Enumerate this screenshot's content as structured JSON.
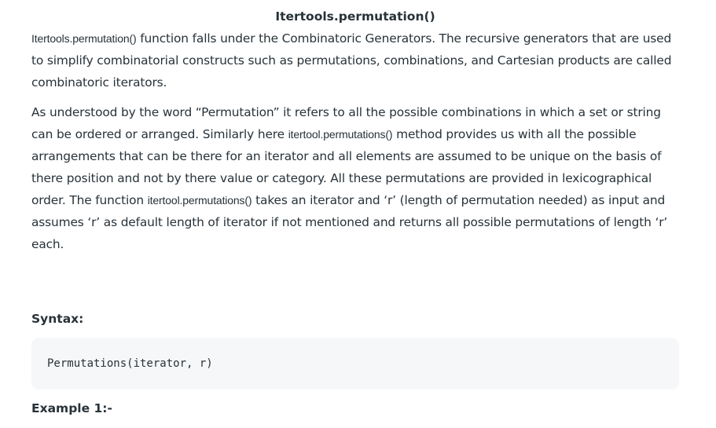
{
  "article": {
    "title": "Itertools.permutation()",
    "paragraph1": {
      "code": "Itertools.permutation()",
      "text": " function falls under the Combinatoric Generators. The recursive generators that are used to simplify combinatorial constructs such as permutations, combinations, and Cartesian products are called combinatoric iterators."
    },
    "paragraph2": {
      "text_a": "As understood by the word “Permutation” it refers to all the possible combinations in which a set or string can be ordered or arranged. Similarly here ",
      "code_a": "itertool.permutations()",
      "text_b": " method provides us with all the possible arrangements that can be there for an iterator and all elements are assumed to be unique on the basis of there position and not by there value or category. All these permutations are provided in lexicographical order. The function ",
      "code_b": "itertool.permutations()",
      "text_c": " takes an iterator and ‘r’ (length of permutation needed) as input and assumes ‘r’ as default length of iterator if not mentioned and returns all possible permutations of length ‘r’ each."
    },
    "syntax_label": "Syntax:",
    "syntax_code": "Permutations(iterator, r)",
    "example_label": "Example 1:-"
  }
}
